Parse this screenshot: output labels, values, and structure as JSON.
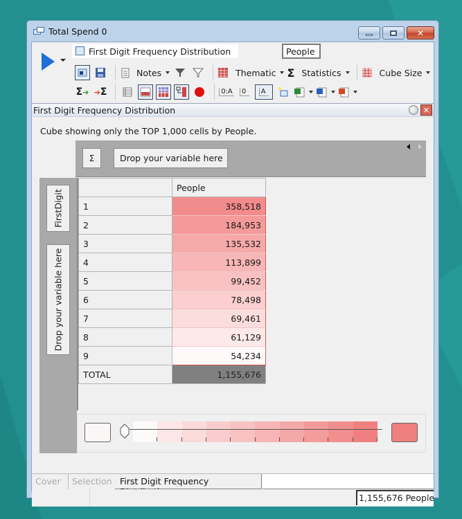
{
  "window": {
    "title": "Total Spend  0",
    "controls": {
      "minimize": "minimize",
      "maximize": "maximize",
      "close": "close"
    }
  },
  "toolbar": {
    "report_title": "First Digit Frequency Distribution",
    "measure": "People",
    "notes_label": "Notes",
    "thematic_label": "Thematic",
    "statistics_label": "Statistics",
    "cube_size_label": "Cube Size",
    "sigma_glyph": "Σ",
    "fmt_btn1": "0:A",
    "fmt_btn2": "0",
    "fmt_btn3": "A"
  },
  "panel": {
    "title": "First Digit Frequency Distribution",
    "info": "Cube showing only the TOP 1,000 cells by People."
  },
  "cube": {
    "column_drop": {
      "sigma": "Σ",
      "label": "Drop your variable here"
    },
    "row_variable": "FirstDigit",
    "row_drop_label": "Drop your variable here",
    "column_header": "People",
    "rows": [
      {
        "label": "1",
        "value": "358,518",
        "color": "#f28b8b"
      },
      {
        "label": "2",
        "value": "184,953",
        "color": "#f49a9a"
      },
      {
        "label": "3",
        "value": "135,532",
        "color": "#f6a9a9"
      },
      {
        "label": "4",
        "value": "113,899",
        "color": "#f8b6b6"
      },
      {
        "label": "5",
        "value": "99,452",
        "color": "#f9c2c2"
      },
      {
        "label": "6",
        "value": "78,498",
        "color": "#fbcfcf"
      },
      {
        "label": "7",
        "value": "69,461",
        "color": "#fcdddd"
      },
      {
        "label": "8",
        "value": "61,129",
        "color": "#fde9e9"
      },
      {
        "label": "9",
        "value": "54,234",
        "color": "#fefafa"
      }
    ],
    "total_label": "TOTAL",
    "total_value": "1,155,676"
  },
  "legend": {
    "low_color": "#fcf7f7",
    "high_color": "#f08080",
    "steps": [
      "#fdfafa",
      "#fce6e6",
      "#fbdada",
      "#f9cdcd",
      "#f8c2c2",
      "#f7b5b5",
      "#f5a8a8",
      "#f49b9b",
      "#f28e8e",
      "#f08080"
    ]
  },
  "tabs": [
    {
      "label": "Cover",
      "active": false
    },
    {
      "label": "Selection",
      "active": false
    },
    {
      "label": "First Digit Frequency Distribution",
      "active": true
    }
  ],
  "status": {
    "total": "1,155,676 People"
  }
}
